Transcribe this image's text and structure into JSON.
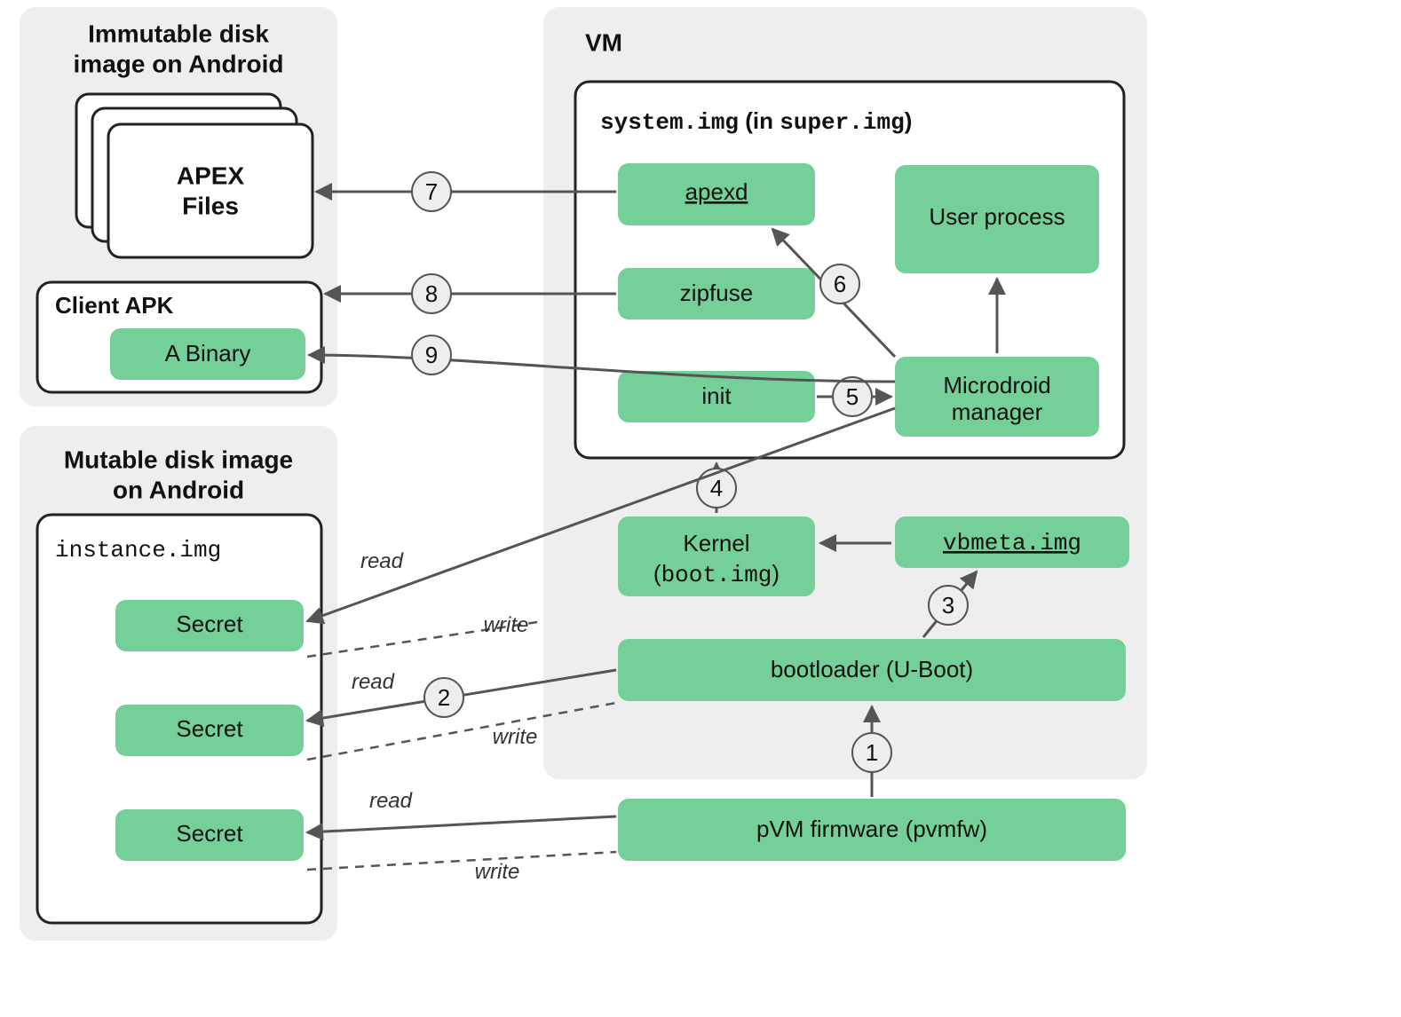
{
  "panels": {
    "immutable_title1": "Immutable disk",
    "immutable_title2": "image on Android",
    "mutable_title1": "Mutable disk image",
    "mutable_title2": "on Android",
    "vm_title": "VM"
  },
  "left": {
    "apex1": "APEX",
    "apex2": "Files",
    "client_apk": "Client APK",
    "a_binary": "A Binary",
    "instance_img": "instance.img",
    "secret": "Secret"
  },
  "vm": {
    "system_img_pre": "system.img",
    "system_img_mid": " (in ",
    "system_img_post": "super.img",
    "system_img_tail": ")",
    "apexd": "apexd",
    "user_process": "User process",
    "zipfuse": "zipfuse",
    "init": "init",
    "microdroid1": "Microdroid",
    "microdroid2": "manager",
    "kernel1": "Kernel",
    "kernel2_pre": "(",
    "kernel2_mono": "boot.img",
    "kernel2_post": ")",
    "vbmeta": "vbmeta.img",
    "bootloader": "bootloader (U-Boot)",
    "pvmfw": "pVM firmware (pvmfw)"
  },
  "edges": {
    "read": "read",
    "write": "write",
    "n1": "1",
    "n2": "2",
    "n3": "3",
    "n4": "4",
    "n5": "5",
    "n6": "6",
    "n7": "7",
    "n8": "8",
    "n9": "9"
  }
}
